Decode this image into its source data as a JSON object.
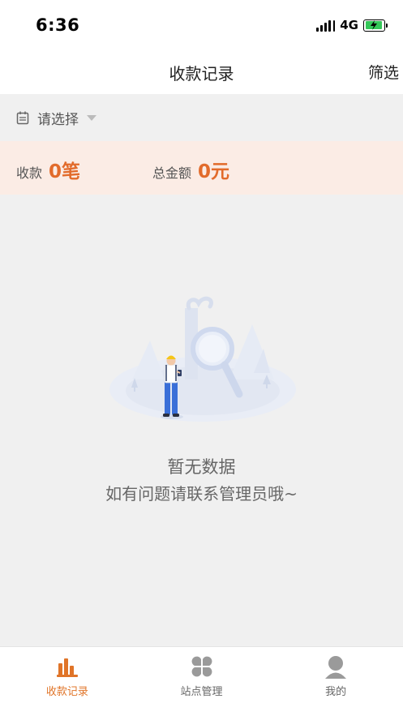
{
  "status_bar": {
    "time": "6:36",
    "network": "4G"
  },
  "nav": {
    "title": "收款记录",
    "filter_label": "筛选"
  },
  "selector": {
    "placeholder": "请选择"
  },
  "summary": {
    "count_label": "收款",
    "count_value": "0笔",
    "amount_label": "总金额",
    "amount_value": "0元"
  },
  "empty_state": {
    "title": "暂无数据",
    "subtitle": "如有问题请联系管理员哦~"
  },
  "tabs": [
    {
      "label": "收款记录",
      "icon": "bar-chart-icon",
      "active": true
    },
    {
      "label": "站点管理",
      "icon": "four-petal-grid-icon",
      "active": false
    },
    {
      "label": "我的",
      "icon": "person-icon",
      "active": false
    }
  ],
  "colors": {
    "accent": "#e26b2b",
    "summary_bg": "#fbece5",
    "page_bg": "#f0f0f0",
    "battery_green": "#35c759"
  }
}
